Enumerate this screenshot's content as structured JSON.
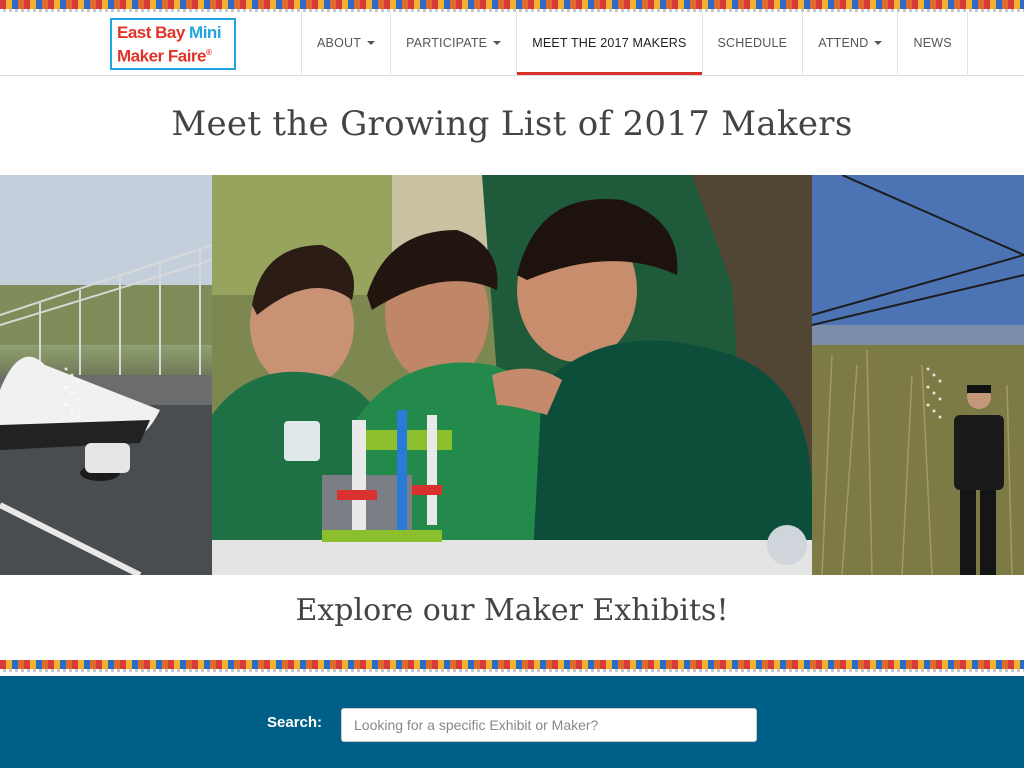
{
  "logo": {
    "line1_a": "East Bay ",
    "line1_b": "Mini",
    "line2": "Maker Faire",
    "reg": "®"
  },
  "nav": {
    "items": [
      {
        "label": "ABOUT",
        "has_caret": true
      },
      {
        "label": "PARTICIPATE",
        "has_caret": true
      },
      {
        "label": "MEET THE 2017 MAKERS",
        "has_caret": false,
        "active": true
      },
      {
        "label": "SCHEDULE",
        "has_caret": false
      },
      {
        "label": "ATTEND",
        "has_caret": true
      },
      {
        "label": "NEWS",
        "has_caret": false
      }
    ]
  },
  "page_title": "Meet the Growing List of 2017 Makers",
  "hero": {
    "left_alt": "solar car photo",
    "center_alt": "three kids building a robot",
    "right_alt": "person in tall grass"
  },
  "explore_heading": "Explore our Maker Exhibits!",
  "search": {
    "label": "Search:",
    "placeholder": "Looking for a specific Exhibit or Maker?",
    "value": ""
  },
  "colors": {
    "accent": "#d9302c",
    "search_band": "#005f86",
    "logo_red": "#e0342b",
    "logo_blue": "#22a6dd"
  }
}
